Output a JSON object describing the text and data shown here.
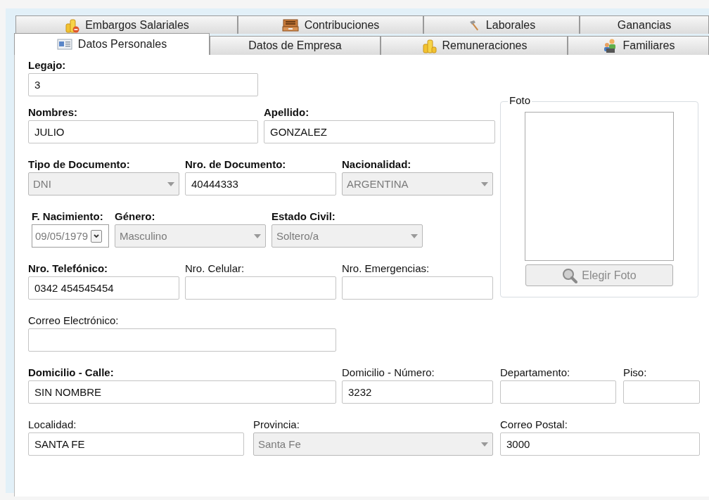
{
  "tab_rows": [
    {
      "tabs": [
        {
          "label": "Embargos Salariales",
          "selected": false
        },
        {
          "label": "Contribuciones",
          "selected": false
        },
        {
          "label": "Laborales",
          "selected": false
        },
        {
          "label": "Ganancias",
          "selected": false
        }
      ]
    },
    {
      "tabs": [
        {
          "label": "Datos Personales",
          "selected": true
        },
        {
          "label": "Datos de Empresa",
          "selected": false
        },
        {
          "label": "Remuneraciones",
          "selected": false
        },
        {
          "label": "Familiares",
          "selected": false
        }
      ]
    }
  ],
  "left_rows": [
    {
      "fields": [
        {
          "kind": "text",
          "label": "Legajo:",
          "required": true,
          "value": "3",
          "disabled": false
        }
      ]
    },
    {
      "fields": [
        {
          "kind": "text",
          "label": "Nombres:",
          "required": true,
          "value": "JULIO",
          "disabled": false
        },
        {
          "kind": "text",
          "label": "Apellido:",
          "required": true,
          "value": "GONZALEZ",
          "disabled": false
        }
      ]
    },
    {
      "fields": [
        {
          "kind": "select",
          "label": "Tipo de Documento:",
          "required": true,
          "value": "DNI",
          "disabled": true
        },
        {
          "kind": "text",
          "label": "Nro. de Documento:",
          "required": true,
          "value": "40444333",
          "disabled": false
        },
        {
          "kind": "select",
          "label": "Nacionalidad:",
          "required": true,
          "value": "ARGENTINA",
          "disabled": true
        }
      ]
    },
    {
      "fields": [
        {
          "kind": "date",
          "label": "F. Nacimiento:",
          "required": true,
          "value": "09/05/1979",
          "disabled": true
        },
        {
          "kind": "select",
          "label": "Género:",
          "required": true,
          "value": "Masculino",
          "disabled": true
        },
        {
          "kind": "select",
          "label": "Estado Civil:",
          "required": true,
          "value": "Soltero/a",
          "disabled": true
        }
      ]
    },
    {
      "fields": [
        {
          "kind": "text",
          "label": "Nro. Telefónico:",
          "required": true,
          "value": "0342 454545454",
          "disabled": false
        },
        {
          "kind": "text",
          "label": "Nro. Celular:",
          "required": false,
          "disabled": false
        },
        {
          "kind": "text",
          "label": "Nro. Emergencias:",
          "required": false,
          "disabled": false
        }
      ]
    },
    {
      "fields": [
        {
          "kind": "text",
          "label": "Correo Electrónico:",
          "required": false,
          "disabled": false
        }
      ]
    }
  ],
  "foto": {
    "title": "Foto",
    "button": {
      "label": "Elegir Foto",
      "disabled": true
    }
  },
  "bottom_rows": [
    {
      "fields": [
        {
          "kind": "text",
          "label": "Domicilio - Calle:",
          "required": true,
          "value": "SIN NOMBRE",
          "disabled": false
        },
        {
          "kind": "text",
          "label": "Domicilio - Número:",
          "required": false,
          "value": "3232",
          "disabled": false
        },
        {
          "kind": "text",
          "label": "Departamento:",
          "required": false,
          "disabled": false
        },
        {
          "kind": "text",
          "label": "Piso:",
          "required": false,
          "disabled": false
        }
      ]
    },
    {
      "fields": [
        {
          "kind": "text",
          "label": "Localidad:",
          "required": false,
          "value": "SANTA FE",
          "disabled": false
        },
        {
          "kind": "select",
          "label": "Provincia:",
          "required": false,
          "value": "Santa Fe",
          "disabled": true
        },
        {
          "kind": "text",
          "label": "Correo Postal:",
          "required": false,
          "value": "3000",
          "disabled": false
        }
      ]
    }
  ]
}
